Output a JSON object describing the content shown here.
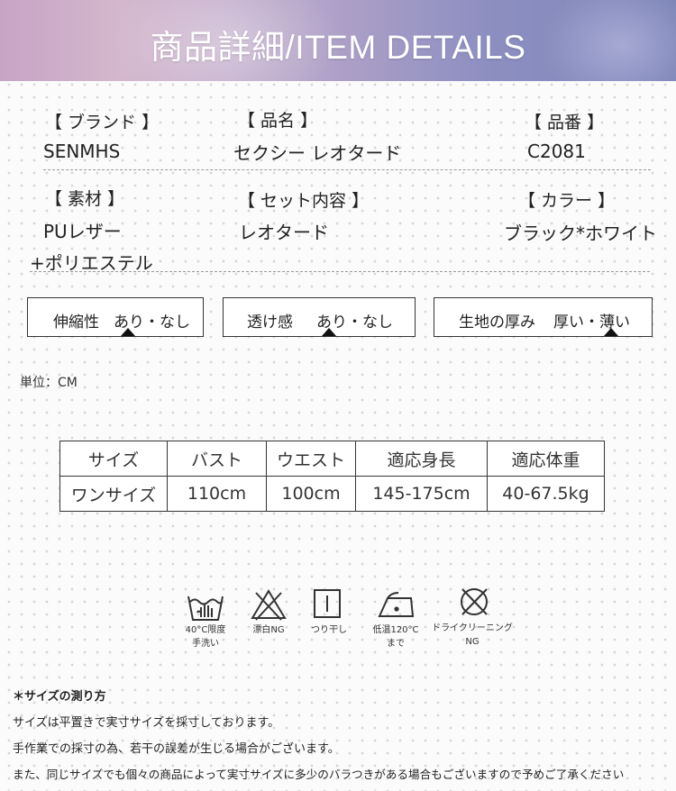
{
  "header": {
    "title": "商品詳細/ITEM DETAILS"
  },
  "details": {
    "brand_label": "【 ブランド 】",
    "brand_value": "SENMHS",
    "name_label": "【 品名 】",
    "name_value": "セクシー レオタード",
    "number_label": "【 品番 】",
    "number_value": "C2081",
    "material_label": "【 素材 】",
    "material_value_1": "PUレザー",
    "material_value_2": "+ポリエステル",
    "set_label": "【 セット内容 】",
    "set_value": "レオタード",
    "color_label": "【 カラー 】",
    "color_value": "ブラック*ホワイト"
  },
  "specs": {
    "stretch_label": "伸縮性",
    "stretch_options": "あり・なし",
    "stretch_selected": "あり",
    "sheer_label": "透け感",
    "sheer_options": "あり・なし",
    "sheer_selected": "あり",
    "thickness_label": "生地の厚み",
    "thickness_options": "厚い・薄い",
    "thickness_selected": "薄い"
  },
  "unit": "単位：CM",
  "size_table": {
    "headers": [
      "サイズ",
      "バスト",
      "ウエスト",
      "適応身長",
      "適応体重"
    ],
    "rows": [
      [
        "ワンサイズ",
        "110cm",
        "100cm",
        "145-175cm",
        "40-67.5kg"
      ]
    ]
  },
  "care": [
    {
      "icon": "hand-wash-icon",
      "label": "40°C限度\n手洗い"
    },
    {
      "icon": "no-bleach-icon",
      "label": "漂白NG"
    },
    {
      "icon": "line-dry-icon",
      "label": "つり干し"
    },
    {
      "icon": "iron-low-icon",
      "label": "低温120°C\nまで"
    },
    {
      "icon": "no-dry-clean-icon",
      "label": "ドライクリーニング\nNG"
    }
  ],
  "notes": {
    "heading": "＊サイズの測り方",
    "line1": "サイズは平置きで実寸サイズを採寸しております。",
    "line2": "手作業での採寸の為、若干の誤差が生じる場合がございます。",
    "line3": "また、同じサイズでも個々の商品によって実寸サイズに多少のバラつきがある場合もございますので予めご了承ください"
  },
  "colors": {
    "banner_start": "#c7a4c4",
    "banner_end": "#7d85b8",
    "text": "#222222"
  }
}
